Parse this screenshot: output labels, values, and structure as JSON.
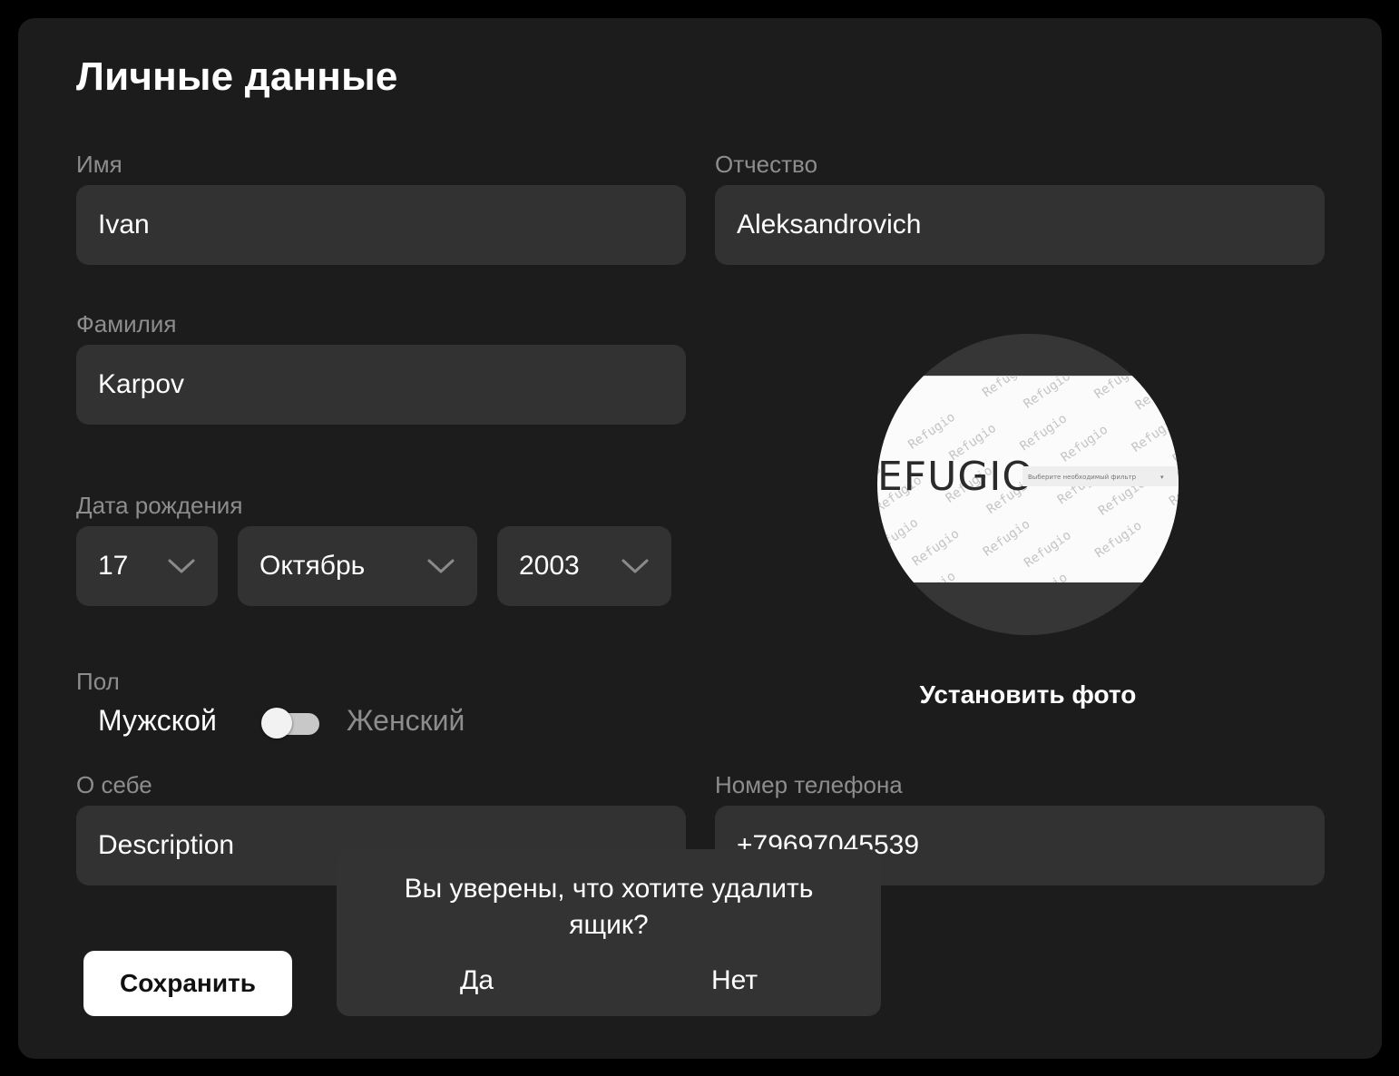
{
  "colors": {
    "background": "#000000",
    "card": "#1c1c1c",
    "input": "#323232",
    "text": "#ffffff",
    "label": "#8d8d8d",
    "inactive_option": "#8d8d8d",
    "button": "#ffffff",
    "dialog": "#333333"
  },
  "form": {
    "title": "Личные данные",
    "first_name": {
      "label": "Имя",
      "value": "Ivan"
    },
    "patronymic": {
      "label": "Отчество",
      "value": "Aleksandrovich"
    },
    "last_name": {
      "label": "Фамилия",
      "value": "Karpov"
    },
    "birth_date": {
      "label": "Дата рождения",
      "day": "17",
      "month": "Октябрь",
      "year": "2003"
    },
    "gender": {
      "label": "Пол",
      "male": "Мужской",
      "female": "Женский",
      "selected": "male"
    },
    "about": {
      "label": "О себе",
      "value": "Description"
    },
    "phone": {
      "label": "Номер телефона",
      "value": "+79697045539"
    },
    "save_label": "Сохранить"
  },
  "photo": {
    "set_photo_label": "Установить фото",
    "logo_text": "EFUGIO",
    "watermark_text": "Refugio",
    "select_placeholder": "Выберите необходимый фильтр"
  },
  "dialog": {
    "message": "Вы уверены, что хотите удалить ящик?",
    "yes_label": "Да",
    "no_label": "Нет"
  }
}
